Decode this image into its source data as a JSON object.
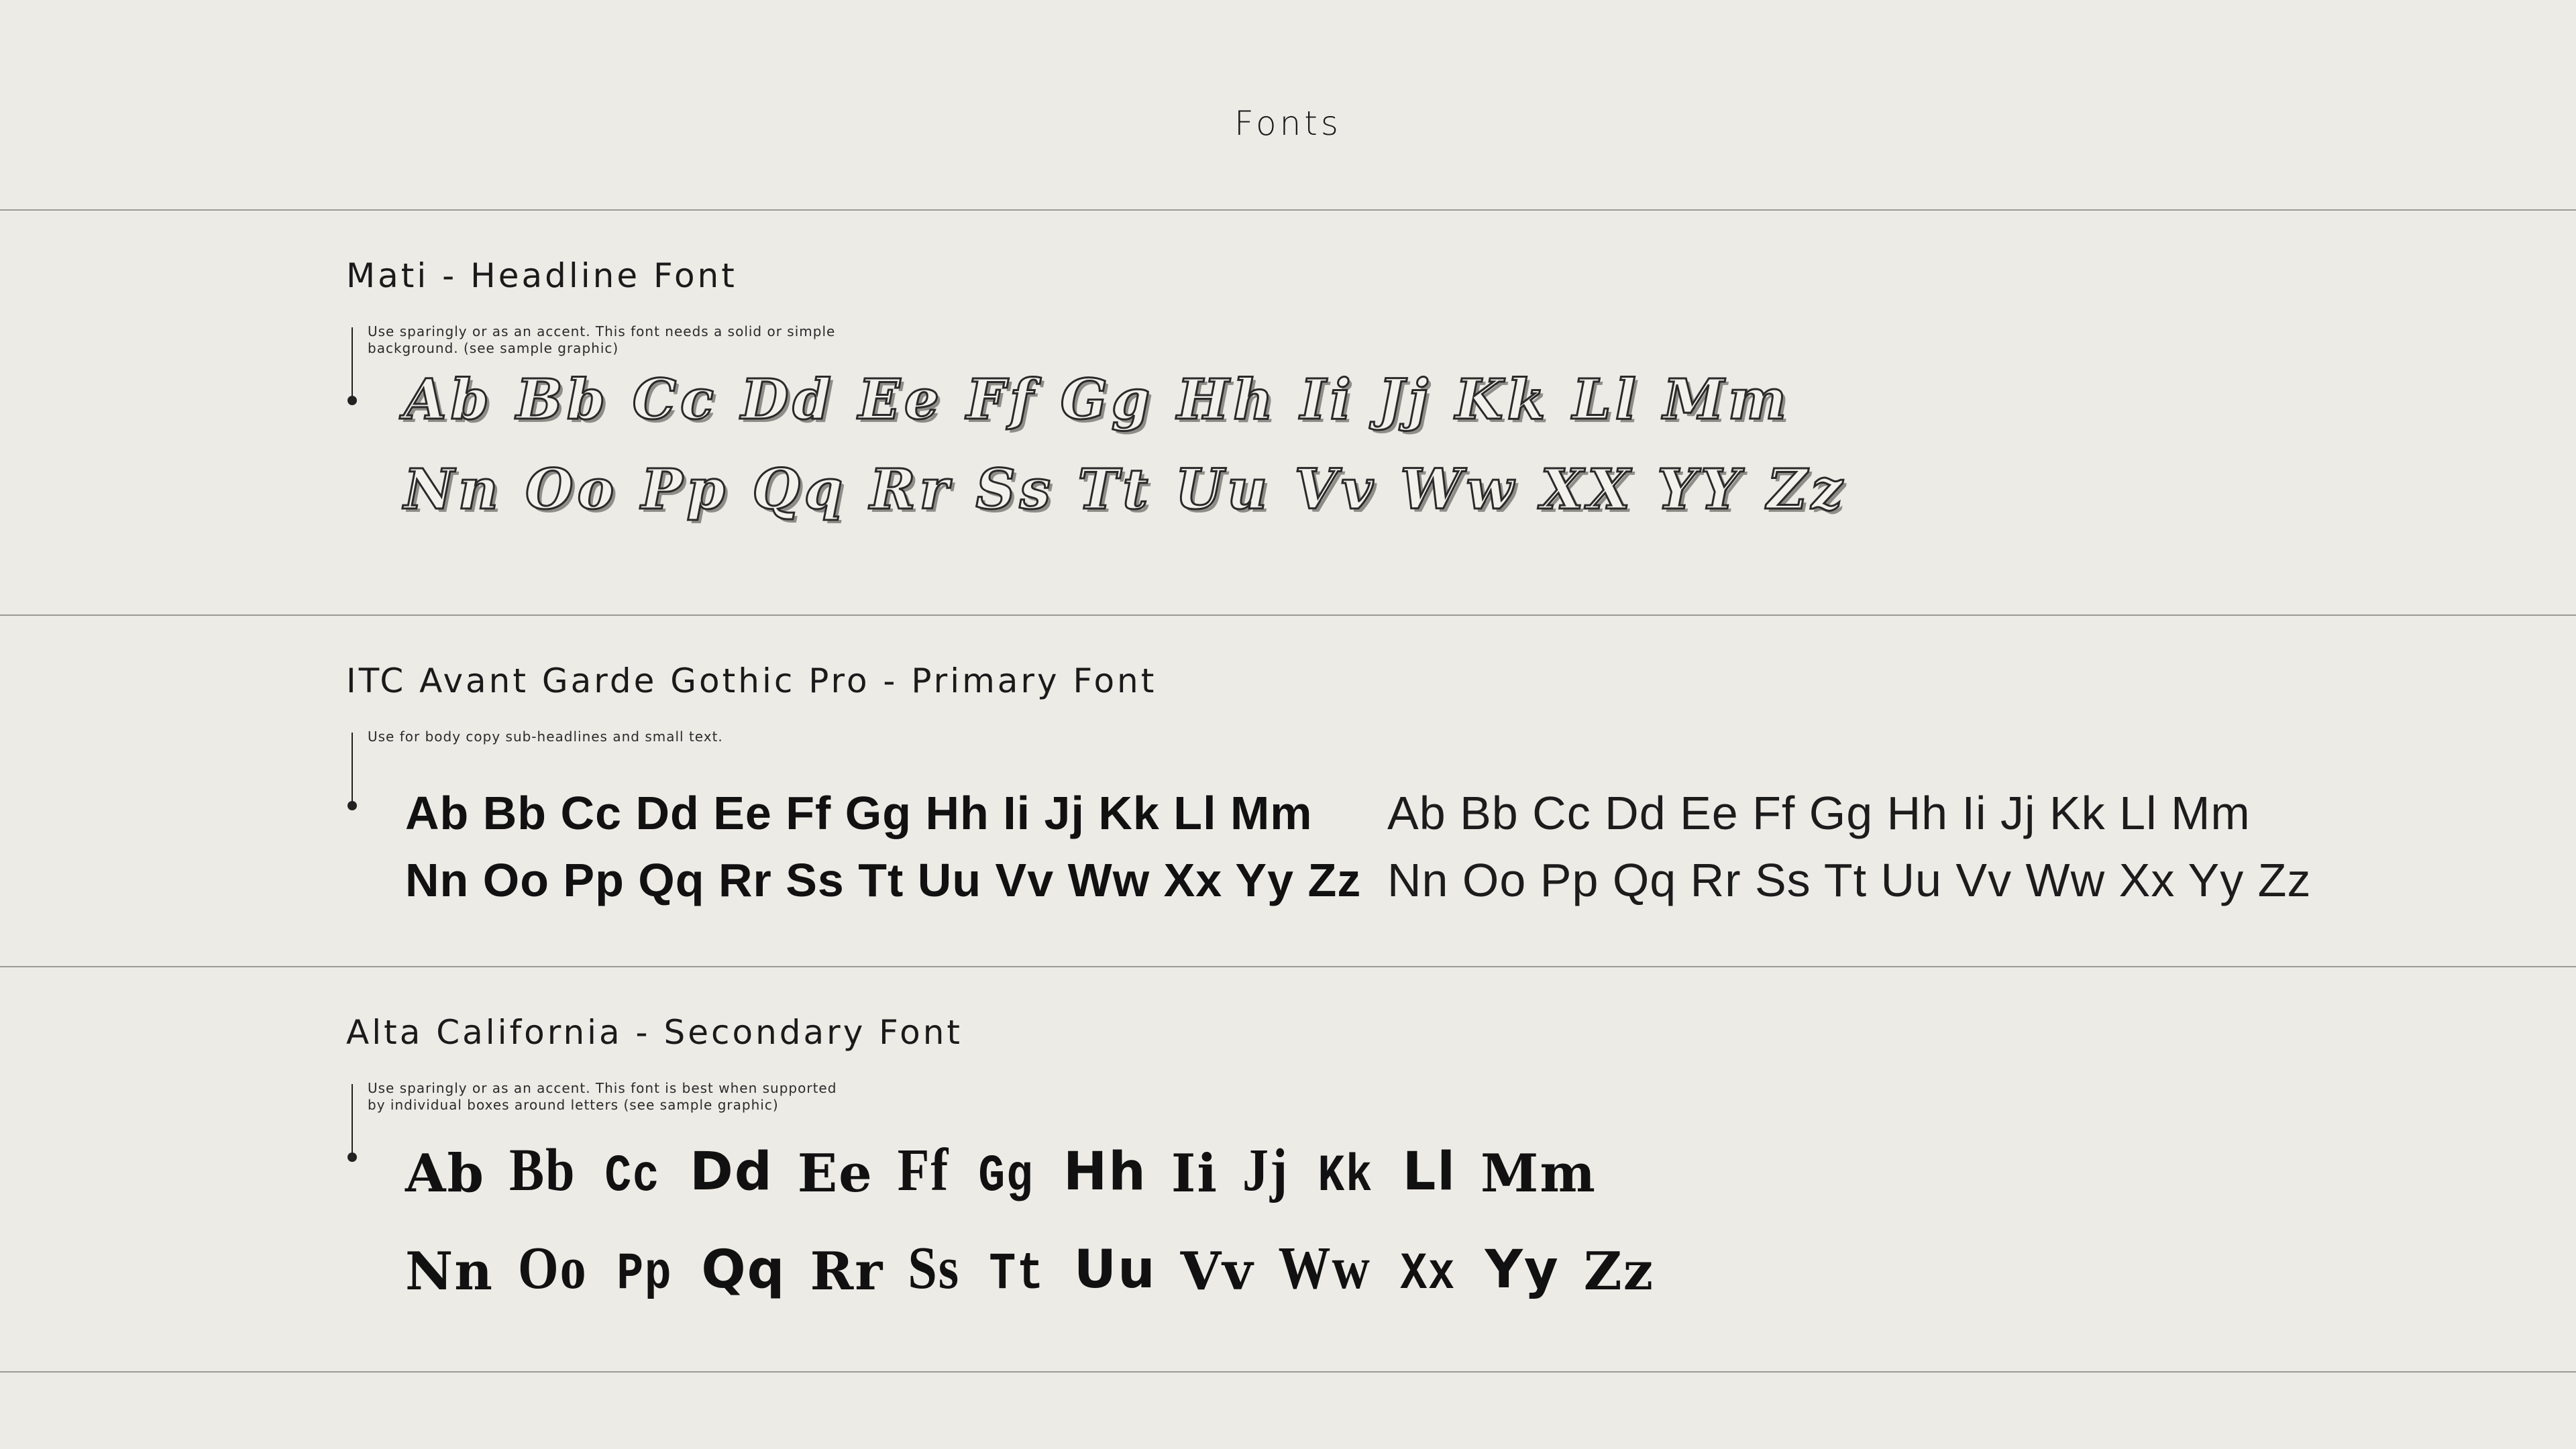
{
  "page": {
    "title": "Fonts"
  },
  "sections": [
    {
      "title": "Mati - Headline Font",
      "note_line1": "Use sparingly or as an accent. This font needs a solid or simple",
      "note_line2": "background. (see sample graphic)",
      "row1": "Ab Bb Cc Dd Ee Ff Gg Hh Ii Jj Kk Ll Mm",
      "row2": "Nn Oo Pp Qq Rr Ss Tt Uu Vv Ww XX YY Zz"
    },
    {
      "title": "ITC Avant Garde Gothic Pro - Primary Font",
      "note_line1": "Use for body copy sub-headlines and small text.",
      "bold_row1": "Ab Bb Cc Dd Ee Ff Gg Hh Ii Jj Kk Ll Mm",
      "bold_row2": "Nn Oo Pp Qq Rr Ss Tt Uu Vv Ww Xx Yy Zz",
      "light_row1": "Ab Bb Cc Dd Ee Ff Gg Hh Ii Jj Kk Ll Mm",
      "light_row2": "Nn Oo Pp Qq Rr Ss Tt Uu Vv Ww Xx Yy Zz"
    },
    {
      "title": "Alta California - Secondary Font",
      "note_line1": "Use sparingly or as an accent. This font is best when supported",
      "note_line2": "by individual boxes around letters (see sample graphic)",
      "row1": [
        "Ab",
        "Bb",
        "Cc",
        "Dd",
        "Ee",
        "Ff",
        "Gg",
        "Hh",
        "Ii",
        "Jj",
        "Kk",
        "Ll",
        "Mm"
      ],
      "row2": [
        "Nn",
        "Oo",
        "Pp",
        "Qq",
        "Rr",
        "Ss",
        "Tt",
        "Uu",
        "Vv",
        "Ww",
        "Xx",
        "Yy",
        "Zz"
      ]
    }
  ]
}
